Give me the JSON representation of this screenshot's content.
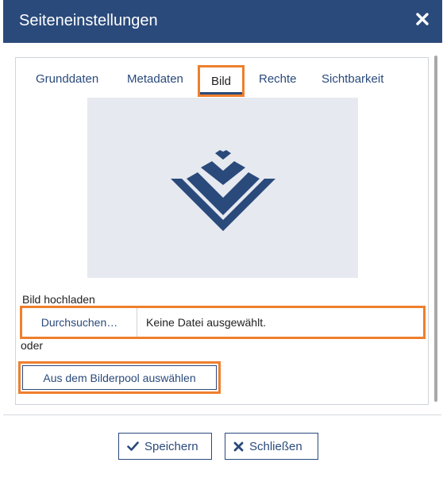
{
  "dialog": {
    "title": "Seiteneinstellungen",
    "close_icon": "close-icon"
  },
  "tabs": [
    {
      "label": "Grunddaten",
      "active": false
    },
    {
      "label": "Metadaten",
      "active": false
    },
    {
      "label": "Bild",
      "active": true
    },
    {
      "label": "Rechte",
      "active": false
    },
    {
      "label": "Sichtbarkeit",
      "active": false
    }
  ],
  "image_tab": {
    "preview_icon": "chevron-logo-placeholder",
    "upload_label": "Bild hochladen",
    "browse_label": "Durchsuchen…",
    "file_status": "Keine Datei ausgewählt.",
    "or_label": "oder",
    "pool_button_label": "Aus dem Bilderpool auswählen"
  },
  "footer": {
    "save_label": "Speichern",
    "save_icon": "checkmark-icon",
    "close_label": "Schließen",
    "close_icon": "x-icon"
  },
  "colors": {
    "header_bg": "#2a4a7b",
    "accent_highlight": "#ee7f2d",
    "preview_bg": "#e6e9f0"
  }
}
